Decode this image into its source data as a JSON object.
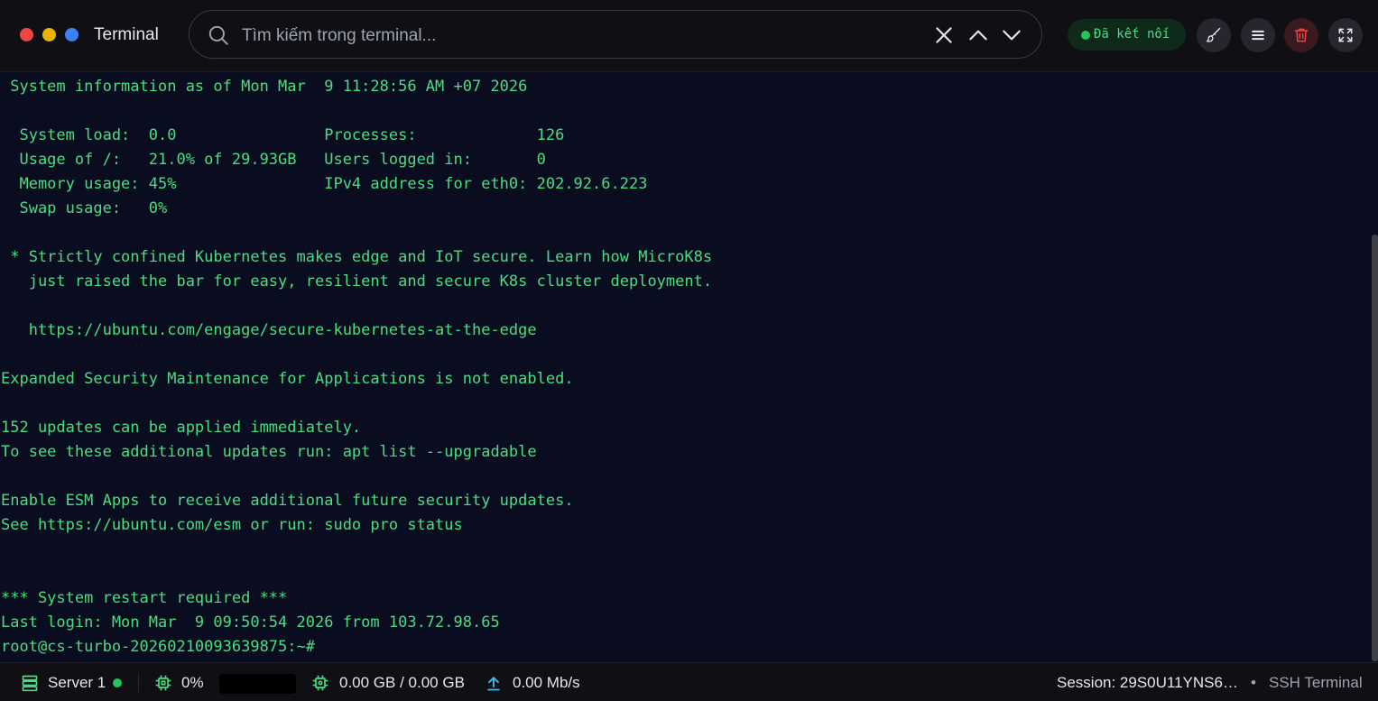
{
  "header": {
    "title": "Terminal",
    "search_placeholder": "Tìm kiếm trong terminal...",
    "status": "Đã kết nối",
    "icons": [
      "search-icon",
      "close-icon",
      "chevron-up-icon",
      "chevron-down-icon",
      "brush-icon",
      "menu-icon",
      "trash-icon",
      "expand-icon"
    ]
  },
  "terminal": {
    "lines": [
      " System information as of Mon Mar  9 11:28:56 AM +07 2026",
      "",
      "  System load:  0.0                Processes:             126",
      "  Usage of /:   21.0% of 29.93GB   Users logged in:       0",
      "  Memory usage: 45%                IPv4 address for eth0: 202.92.6.223",
      "  Swap usage:   0%",
      "",
      " * Strictly confined Kubernetes makes edge and IoT secure. Learn how MicroK8s",
      "   just raised the bar for easy, resilient and secure K8s cluster deployment.",
      "",
      "   https://ubuntu.com/engage/secure-kubernetes-at-the-edge",
      "",
      "Expanded Security Maintenance for Applications is not enabled.",
      "",
      "152 updates can be applied immediately.",
      "To see these additional updates run: apt list --upgradable",
      "",
      "Enable ESM Apps to receive additional future security updates.",
      "See https://ubuntu.com/esm or run: sudo pro status",
      "",
      "",
      "*** System restart required ***",
      "Last login: Mon Mar  9 09:50:54 2026 from 103.72.98.65",
      "root@cs-turbo-20260210093639875:~#"
    ]
  },
  "footer": {
    "server": "Server 1",
    "cpu": "0%",
    "cpu_fraction": 0.0,
    "memory": "0.00 GB / 0.00 GB",
    "network": "0.00 Mb/s",
    "session": "Session: 29S0U11YNS6_...",
    "separator": "•",
    "connection_type": "SSH Terminal"
  },
  "colors": {
    "terminal_bg": "#0a0c20",
    "terminal_text": "#4ade80",
    "status_green": "#22c55e",
    "header_bg": "#0f0f14"
  }
}
